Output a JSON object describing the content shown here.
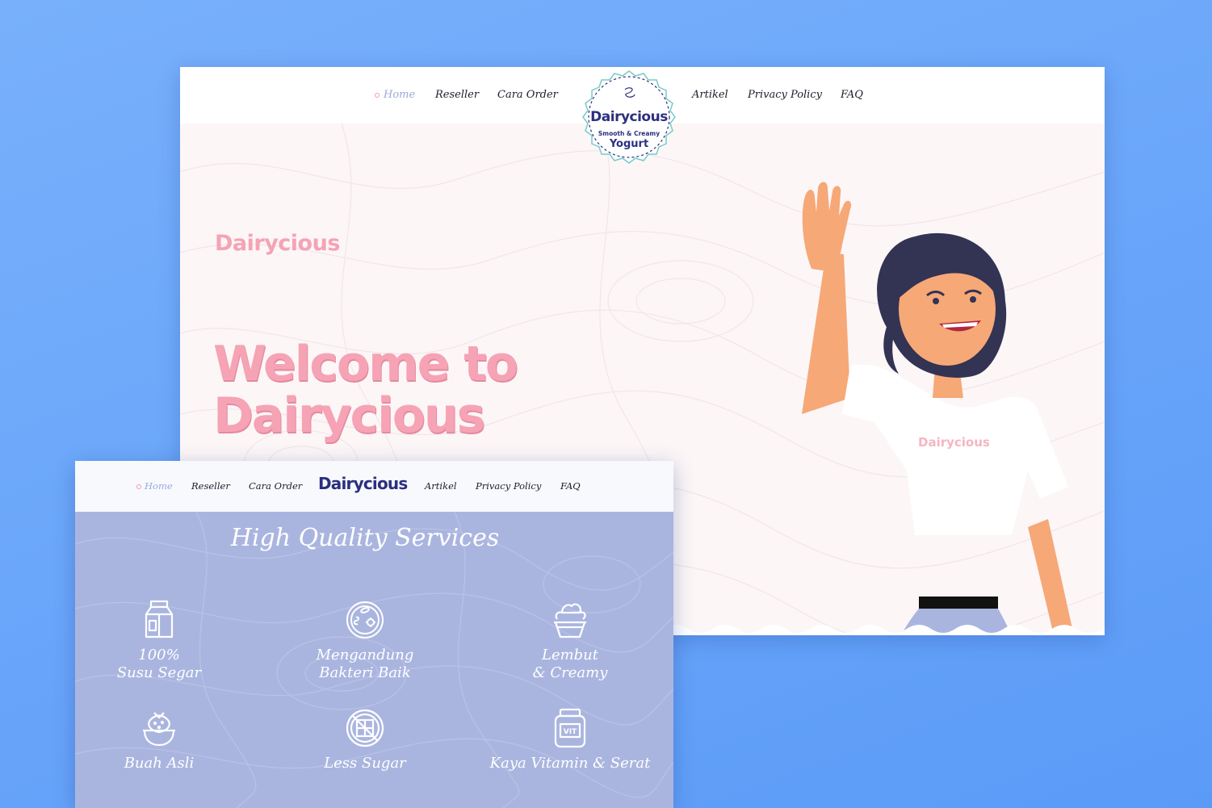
{
  "colors": {
    "background": "#5b9bf8",
    "brand_pink": "#f5a3b5",
    "brand_navy": "#2c2f7e",
    "services_bg": "#aab5df",
    "nav_active": "#9aa9de"
  },
  "hero_page": {
    "nav": {
      "home": "Home",
      "reseller": "Reseller",
      "cara_order": "Cara Order",
      "artikel": "Artikel",
      "privacy_policy": "Privacy Policy",
      "faq": "FAQ"
    },
    "badge": {
      "brand": "Dairycious",
      "tagline": "Smooth & Creamy",
      "product": "Yogurt"
    },
    "logo_text": "Dairycious",
    "headline_line1": "Welcome to",
    "headline_line2": "Dairycious",
    "shirt_logo": "Dairycious"
  },
  "services_page": {
    "nav": {
      "home": "Home",
      "reseller": "Reseller",
      "cara_order": "Cara Order",
      "brand": "Dairycious",
      "artikel": "Artikel",
      "privacy_policy": "Privacy Policy",
      "faq": "FAQ"
    },
    "title": "High Quality Services",
    "features": [
      {
        "icon": "milk-carton-icon",
        "line1": "100%",
        "line2": "Susu Segar"
      },
      {
        "icon": "bacteria-icon",
        "line1": "Mengandung",
        "line2": "Bakteri Baik"
      },
      {
        "icon": "yogurt-cup-icon",
        "line1": "Lembut",
        "line2": "& Creamy"
      },
      {
        "icon": "strawberry-bowl-icon",
        "line1": "Buah Asli",
        "line2": ""
      },
      {
        "icon": "no-sugar-icon",
        "line1": "Less Sugar",
        "line2": ""
      },
      {
        "icon": "vitamin-jar-icon",
        "line1": "Kaya Vitamin & Serat",
        "line2": ""
      }
    ]
  }
}
